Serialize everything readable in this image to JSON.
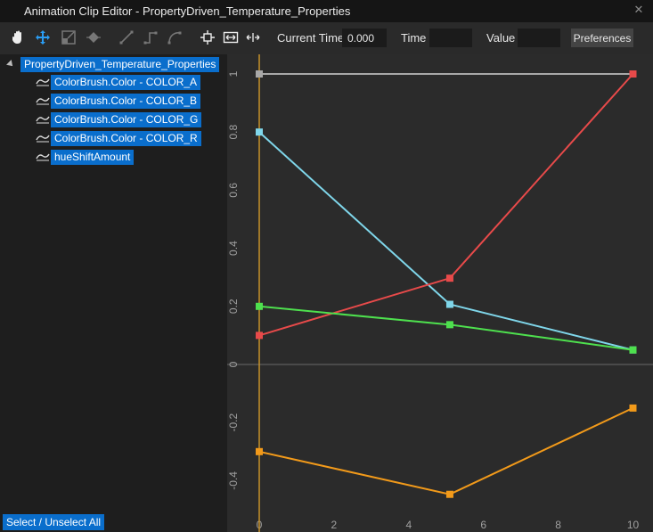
{
  "window": {
    "title": "Animation Clip Editor - PropertyDriven_Temperature_Properties",
    "close_icon": "close-icon"
  },
  "toolbar": {
    "tools": [
      "hand-tool-icon",
      "move-tool-icon",
      "scale-tool-icon",
      "keyframe-tool-icon",
      "linear-tangent-icon",
      "step-tangent-icon",
      "smooth-tangent-icon",
      "frame-selection-icon",
      "fit-horizontal-icon",
      "fit-width-icon"
    ],
    "current_time_label": "Current Time",
    "current_time_value": "0.000",
    "time_label": "Time",
    "time_value": "",
    "value_label": "Value",
    "value_value": "",
    "preferences_label": "Preferences"
  },
  "tree": {
    "root": "PropertyDriven_Temperature_Properties",
    "properties": [
      "ColorBrush.Color - COLOR_A",
      "ColorBrush.Color - COLOR_B",
      "ColorBrush.Color - COLOR_G",
      "ColorBrush.Color - COLOR_R",
      "hueShiftAmount"
    ]
  },
  "footer": {
    "select_all_label": "Select / Unselect All"
  },
  "chart_data": {
    "type": "line",
    "x_ticks": [
      0,
      2,
      4,
      6,
      8,
      10
    ],
    "y_ticks": [
      -0.4,
      -0.2,
      0,
      0.2,
      0.4,
      0.6,
      0.8,
      1
    ],
    "y_tick_labels": [
      "-0.4",
      "-0.2",
      "0",
      "0.2",
      "0.4",
      "0.6",
      "0.8",
      "1"
    ],
    "current_time": 0,
    "series": [
      {
        "color": "#a8a8a8",
        "points": [
          [
            0,
            1
          ],
          [
            10,
            1
          ]
        ]
      },
      {
        "color": "#7fd6ea",
        "points": [
          [
            0,
            0.8
          ],
          [
            5.1,
            0.207
          ],
          [
            10,
            0.05
          ]
        ]
      },
      {
        "color": "#e84a4a",
        "points": [
          [
            0,
            0.1
          ],
          [
            5.1,
            0.297
          ],
          [
            10,
            1
          ]
        ]
      },
      {
        "color": "#4ee04e",
        "points": [
          [
            0,
            0.2
          ],
          [
            5.1,
            0.137
          ],
          [
            10,
            0.05
          ]
        ]
      },
      {
        "color": "#f29a1a",
        "points": [
          [
            0,
            -0.3
          ],
          [
            5.1,
            -0.447
          ],
          [
            10,
            -0.15
          ]
        ]
      }
    ]
  }
}
